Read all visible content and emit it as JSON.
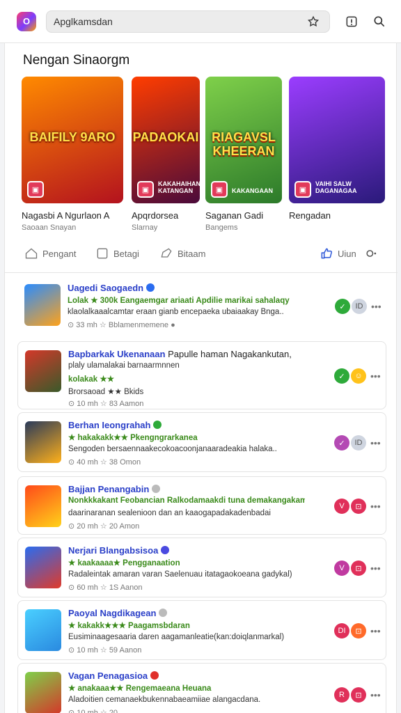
{
  "toolbar": {
    "logo_text": "O",
    "url_text": "Apglkamsdan",
    "star_icon": "star-outline-icon",
    "info_icon": "info-square-icon",
    "search_icon": "search-icon"
  },
  "section": {
    "heading": "Nengan Sinaorgm"
  },
  "featured": [
    {
      "art_text": "BAIFILY 9ARO",
      "art_sub": "",
      "title": "Nagasbi A Ngurlaon A",
      "subtitle": "Saoaan Snayan",
      "colors": [
        "#ff8a00",
        "#b3121e"
      ]
    },
    {
      "art_text": "PADAOKAI",
      "art_sub": "KAKAHAIHAN KATANGAN",
      "title": "Apqrdorsea",
      "subtitle": "Slarnay",
      "colors": [
        "#ff3d00",
        "#4a0a3a"
      ]
    },
    {
      "art_text": "RIAGAVSL KHEERAN",
      "art_sub": "KAKANGAAN",
      "title": "Saganan Gadi",
      "subtitle": "Bangems",
      "colors": [
        "#7fd04a",
        "#2c7a2a"
      ]
    },
    {
      "art_text": "",
      "art_sub": "VAIHI SALW DAGANAGAA",
      "title": "Rengadan",
      "subtitle": "",
      "colors": [
        "#9b3dff",
        "#2a1a7a"
      ]
    }
  ],
  "tabs": [
    {
      "label": "Pengant",
      "icon": "home-icon"
    },
    {
      "label": "Betagi",
      "icon": "square-icon"
    },
    {
      "label": "Bitaam",
      "icon": "tag-icon"
    },
    {
      "label": "Uiun",
      "icon": "thumbs-up-icon"
    },
    {
      "label": "",
      "icon": "more-icon"
    }
  ],
  "apps": [
    {
      "title": "Uagedi Saogaedn",
      "verified_color": "#2a6cf0",
      "line1": "Lolak ★ 300k  Eangaemgar ariaati Apdilie marikai sahalaqy",
      "line2": "klaolalkaaalcamtar eraan gianb encepaeka ubaiaakay Bnga..",
      "line3": "",
      "meta": "⊙ 33 mh    ☆ Bblamenmemene  ●",
      "colors": [
        "#2a8cff",
        "#ffa21a"
      ],
      "a1": "#2eaa3a",
      "a1t": "✓",
      "a2": "#cfd5e0",
      "a2t": "ID"
    },
    {
      "title": "Bapbarkak Ukenanaan",
      "title_extra": "Papulle haman Nagakankutan,",
      "line1": "plaly ulamalakai barnaarmnnen",
      "line2": "kolakak ★★",
      "line3": "Brorsaoad ★★ Bkids",
      "meta": "⊙ 10 mh    ☆ 83 Aamon",
      "colors": [
        "#d4382a",
        "#3a5a2a"
      ],
      "a1": "#2eaa3a",
      "a1t": "✓",
      "a2": "#ffc21a",
      "a2t": "☺"
    },
    {
      "title": "Berhan Ieongrahah",
      "verified_color": "#2eaa3a",
      "line1": "★ hakakakk★★  Pkengngrarkanea",
      "line2": "Sengoden bersaennaakecokoacoonjanaaradeakia halaka..",
      "line3": "",
      "meta": "⊙ 40 mh    ☆ 38 Omon",
      "colors": [
        "#2a3a5a",
        "#ffb01a"
      ],
      "a1": "#b44ab4",
      "a1t": "✓",
      "a2": "#cfd5e0",
      "a2t": "ID"
    },
    {
      "title": "Bajjan Penangabin",
      "verified_color": "#bbbbbb",
      "line1": "Nonkkkakant  Feobancian Ralkodamaakdi tuna demakangakam",
      "line2": "daarinaranan sealenioon dan an kaaogapadakadenbadai",
      "line3": "",
      "meta": "⊙ 20 mh    ☆ 20 Amon",
      "colors": [
        "#ff4a1a",
        "#ffd21a"
      ],
      "a1": "#e0305a",
      "a1t": "V",
      "a2": "#e0305a",
      "a2t": "⊡"
    },
    {
      "title": "Nerjari Blangabsisoa",
      "verified_color": "#4a4ae0",
      "line1": "★ kaakaaaa★  Pengganaation",
      "line2": "Radaleintak amaran varan Saelenuau itatagaokoeana gadykal)",
      "line3": "",
      "meta": "⊙ 60 mh    ☆ 1S Aanon",
      "colors": [
        "#2a6cf0",
        "#e03a2a"
      ],
      "a1": "#c03aa0",
      "a1t": "V",
      "a2": "#e0305a",
      "a2t": "⊡"
    },
    {
      "title": "Paoyal Nagdikagean",
      "verified_color": "#bbbbbb",
      "line1": "★ kakakk★★★  Paagamsbdaran",
      "line2": "Eusiminaagesaaria daren aagamanleatie(kan:doiqlanmarkal)",
      "line3": "",
      "meta": "⊙ 10 mh    ☆ 59 Aanon",
      "colors": [
        "#4acfff",
        "#2a8ae0"
      ],
      "a1": "#e0305a",
      "a1t": "DI",
      "a2": "#ff6a2a",
      "a2t": "⊡"
    },
    {
      "title": "Vagan Penagasioa",
      "verified_color": "#e0302a",
      "line1": "★ anakaaa★★  Rengemaeana  Heuana",
      "line2": "Aladoitien cemanaekbukennabaeamiiae alangacdana.",
      "line3": "",
      "meta": "⊙ 10 mh    ☆ 20",
      "colors": [
        "#7fd04a",
        "#d4382a"
      ],
      "a1": "#e0305a",
      "a1t": "R",
      "a2": "#e0305a",
      "a2t": "⊡"
    }
  ]
}
